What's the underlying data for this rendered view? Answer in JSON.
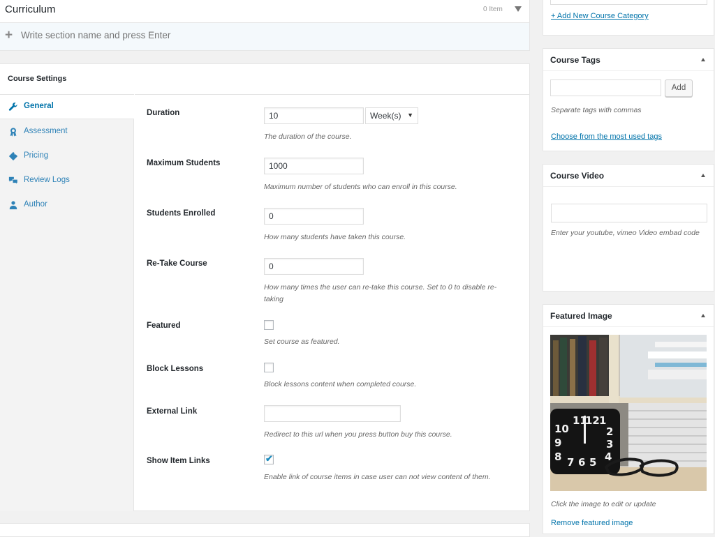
{
  "curriculum": {
    "title": "Curriculum",
    "item_count": "0 Item",
    "section_placeholder": "Write section name and press Enter"
  },
  "course_settings": {
    "title": "Course Settings",
    "tabs": [
      {
        "label": "General",
        "icon": "wrench-icon",
        "active": true
      },
      {
        "label": "Assessment",
        "icon": "award-icon",
        "active": false
      },
      {
        "label": "Pricing",
        "icon": "tag-icon",
        "active": false
      },
      {
        "label": "Review Logs",
        "icon": "chat-bubbles-icon",
        "active": false
      },
      {
        "label": "Author",
        "icon": "user-icon",
        "active": false
      }
    ],
    "fields": {
      "duration": {
        "label": "Duration",
        "value": "10",
        "unit": "Week(s)",
        "description": "The duration of the course."
      },
      "max_students": {
        "label": "Maximum Students",
        "value": "1000",
        "description": "Maximum number of students who can enroll in this course."
      },
      "students_enrolled": {
        "label": "Students Enrolled",
        "value": "0",
        "description": "How many students have taken this course."
      },
      "retake": {
        "label": "Re-Take Course",
        "value": "0",
        "description": "How many times the user can re-take this course. Set to 0 to disable re-taking"
      },
      "featured": {
        "label": "Featured",
        "checked": false,
        "description": "Set course as featured."
      },
      "block_lessons": {
        "label": "Block Lessons",
        "checked": false,
        "description": "Block lessons content when completed course."
      },
      "external_link": {
        "label": "External Link",
        "value": "",
        "description": "Redirect to this url when you press button buy this course."
      },
      "show_item_links": {
        "label": "Show Item Links",
        "checked": true,
        "check_mark": "✔",
        "description": "Enable link of course items in case user can not view content of them."
      }
    }
  },
  "sidebar": {
    "category": {
      "add_link": "+ Add New Course Category"
    },
    "tags": {
      "title": "Course Tags",
      "add_button": "Add",
      "note": "Separate tags with commas",
      "most_used_link": "Choose from the most used tags"
    },
    "video": {
      "title": "Course Video",
      "note": "Enter your youtube, vimeo Video embad code"
    },
    "featured_image": {
      "title": "Featured Image",
      "note": "Click the image to edit or update",
      "remove_link": "Remove featured image"
    }
  },
  "colors": {
    "accent": "#0073aa",
    "link": "#0073aa",
    "checkbox_tick": "#1e8cbe",
    "curriculum_row_bg": "#f4f9fc"
  }
}
